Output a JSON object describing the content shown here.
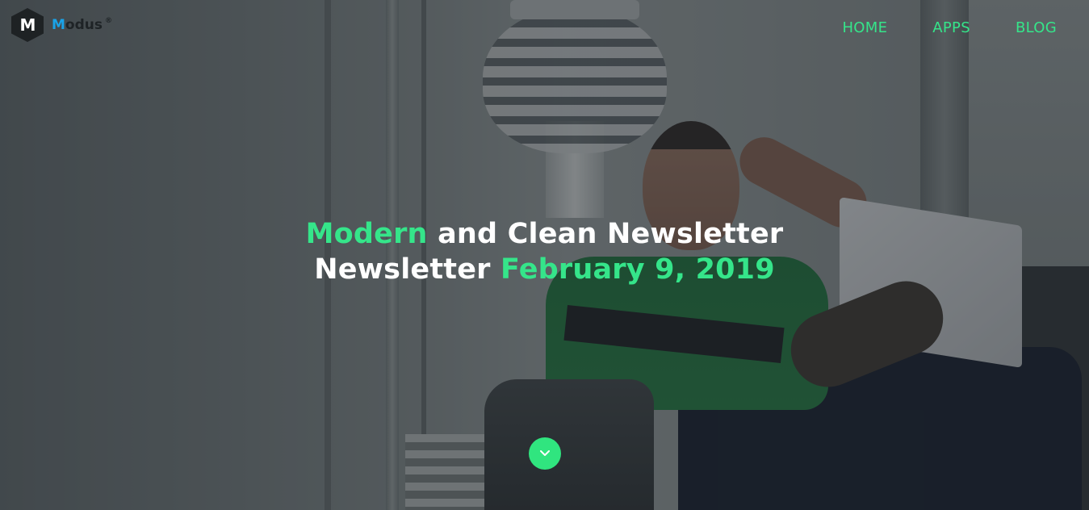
{
  "brand": {
    "logo_letter": "M",
    "name_first": "M",
    "name_rest": "odus",
    "registered": "®"
  },
  "nav": {
    "items": [
      {
        "label": "HOME"
      },
      {
        "label": "APPS"
      },
      {
        "label": "BLOG"
      }
    ]
  },
  "hero": {
    "line1_accent": "Modern",
    "line1_rest": "and Clean Newsletter",
    "line2_start": "Newsletter",
    "line2_accent": "February 9, 2019",
    "scroll_icon": "chevron-down-icon"
  },
  "colors": {
    "accent": "#35e58a",
    "brand_blue": "#1aa3e8",
    "scroll_button": "#30e57f"
  }
}
